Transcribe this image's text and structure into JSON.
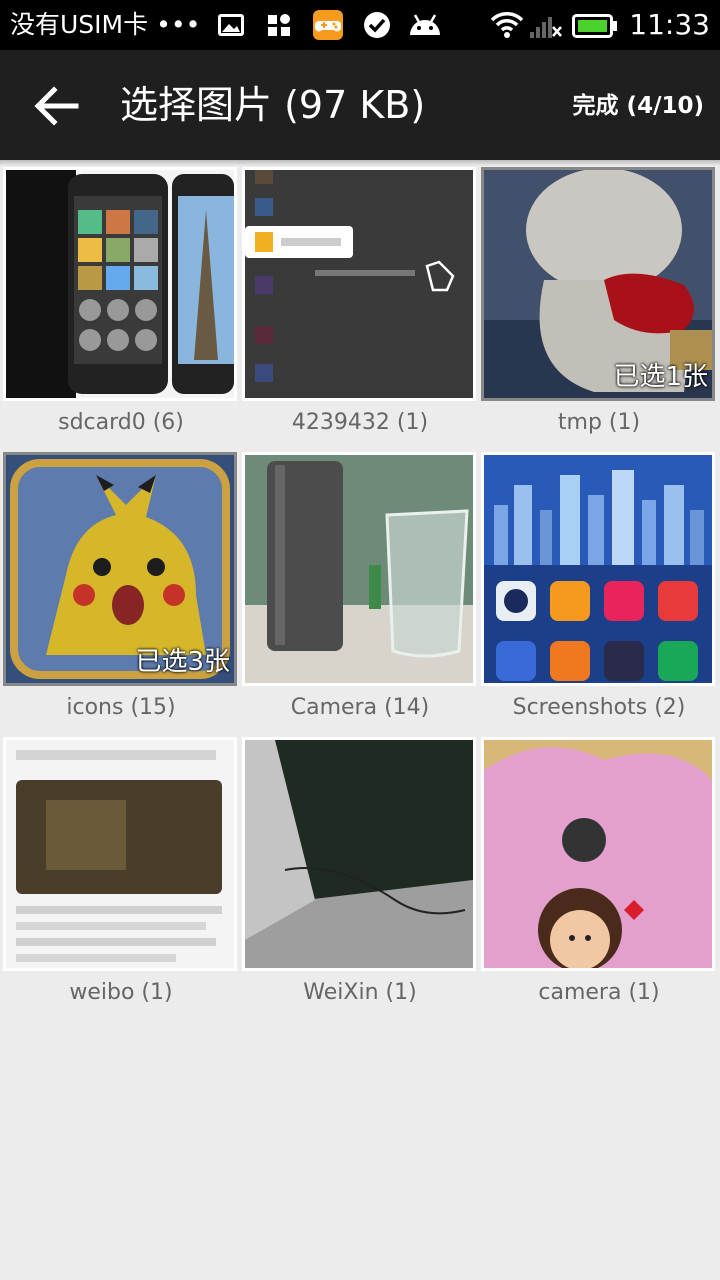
{
  "status_bar": {
    "carrier": "没有USIM卡",
    "overflow": "•••",
    "icons": [
      "image-icon",
      "grid-icon",
      "game-icon",
      "check-icon",
      "android-icon",
      "wifi-icon",
      "signal-icon",
      "battery-icon"
    ],
    "time": "11:33"
  },
  "app_bar": {
    "title": "选择图片 (97 KB)",
    "done_label": "完成 (4/10)"
  },
  "albums": [
    {
      "name": "sdcard0 (6)",
      "badge": ""
    },
    {
      "name": "4239432 (1)",
      "badge": ""
    },
    {
      "name": "tmp (1)",
      "badge": "已选1张"
    },
    {
      "name": "icons (15)",
      "badge": "已选3张"
    },
    {
      "name": "Camera (14)",
      "badge": ""
    },
    {
      "name": "Screenshots (2)",
      "badge": ""
    },
    {
      "name": "weibo (1)",
      "badge": ""
    },
    {
      "name": "WeiXin (1)",
      "badge": ""
    },
    {
      "name": "camera (1)",
      "badge": ""
    }
  ],
  "colors": {
    "appbar": "#1f1f1f",
    "statusbar": "#000000",
    "background": "#ececec",
    "battery": "#4cd02a"
  }
}
